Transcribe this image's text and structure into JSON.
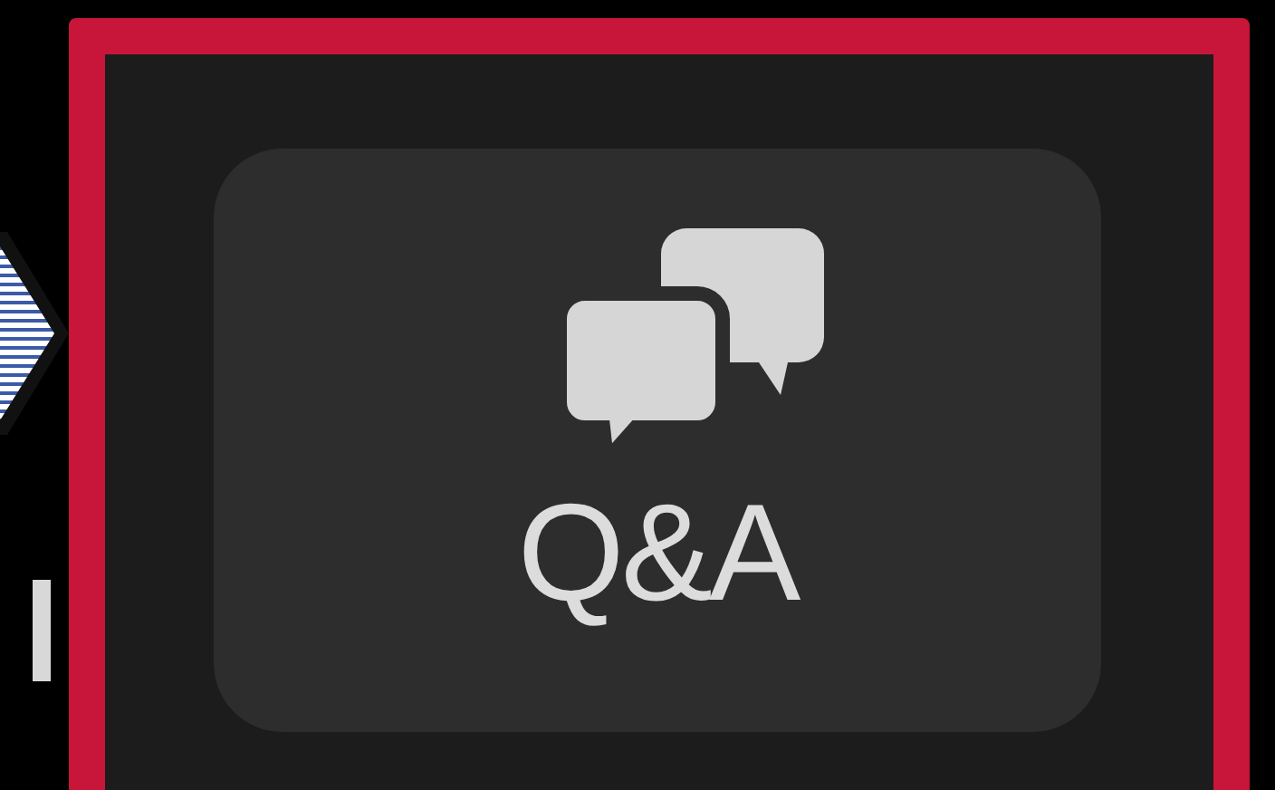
{
  "button": {
    "label": "Q&A"
  }
}
